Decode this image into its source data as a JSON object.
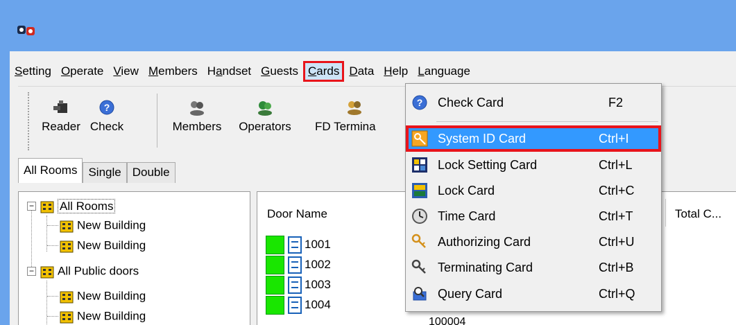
{
  "menubar": {
    "items": [
      {
        "pre": "",
        "u": "S",
        "post": "etting"
      },
      {
        "pre": "",
        "u": "O",
        "post": "perate"
      },
      {
        "pre": "",
        "u": "V",
        "post": "iew"
      },
      {
        "pre": "",
        "u": "M",
        "post": "embers"
      },
      {
        "pre": "H",
        "u": "a",
        "post": "ndset"
      },
      {
        "pre": "",
        "u": "G",
        "post": "uests"
      },
      {
        "pre": "",
        "u": "C",
        "post": "ards"
      },
      {
        "pre": "",
        "u": "D",
        "post": "ata"
      },
      {
        "pre": "",
        "u": "H",
        "post": "elp"
      },
      {
        "pre": "",
        "u": "L",
        "post": "anguage"
      }
    ]
  },
  "toolbar": {
    "reader": "Reader",
    "check": "Check",
    "members": "Members",
    "operators": "Operators",
    "fd_terminal": "FD Termina"
  },
  "tabs": [
    "All Rooms",
    "Single",
    "Double"
  ],
  "tree": {
    "nodes": [
      "All Rooms",
      "New Building",
      "New Building",
      "All Public doors",
      "New Building",
      "New Building"
    ],
    "expander": "−"
  },
  "list": {
    "headers": {
      "door_name": "Door Name",
      "total": "Total C..."
    },
    "rows": [
      "1001",
      "1002",
      "1003",
      "1004"
    ],
    "partial_text": "100004"
  },
  "cards_menu": {
    "items": [
      {
        "label": "Check Card",
        "shortcut": "F2",
        "icon": "question-icon"
      },
      {
        "label": "System ID Card",
        "shortcut": "Ctrl+I",
        "icon": "key-icon"
      },
      {
        "label": "Lock Setting Card",
        "shortcut": "Ctrl+L",
        "icon": "lock-setting-icon"
      },
      {
        "label": "Lock Card",
        "shortcut": "Ctrl+C",
        "icon": "lock-card-icon"
      },
      {
        "label": "Time Card",
        "shortcut": "Ctrl+T",
        "icon": "clock-icon"
      },
      {
        "label": "Authorizing Card",
        "shortcut": "Ctrl+U",
        "icon": "authorize-keys-icon"
      },
      {
        "label": "Terminating Card",
        "shortcut": "Ctrl+B",
        "icon": "terminate-keys-icon"
      },
      {
        "label": "Query Card",
        "shortcut": "Ctrl+Q",
        "icon": "query-icon"
      }
    ]
  },
  "colors": {
    "titlebar": "#6aa4ec",
    "highlight": "#3399ff",
    "callout_red": "#e8141b",
    "status_green": "#19e600",
    "door_blue": "#1861b8"
  }
}
